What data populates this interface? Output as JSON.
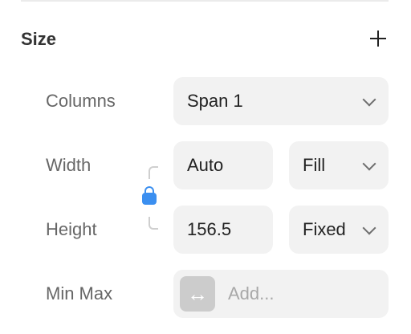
{
  "section": {
    "title": "Size",
    "add_icon": "plus-icon"
  },
  "rows": {
    "columns": {
      "label": "Columns",
      "value": "Span 1"
    },
    "width": {
      "label": "Width",
      "value": "Auto",
      "mode": "Fill"
    },
    "height": {
      "label": "Height",
      "value": "156.5",
      "mode": "Fixed"
    },
    "min_max": {
      "label": "Min Max",
      "placeholder": "Add...",
      "icon": "↔"
    }
  },
  "lock": {
    "icon": "lock-icon",
    "color": "#3b8ff0",
    "state": "locked"
  },
  "colors": {
    "field_bg": "#f2f2f2",
    "label": "#666666",
    "accent": "#3b8ff0"
  }
}
